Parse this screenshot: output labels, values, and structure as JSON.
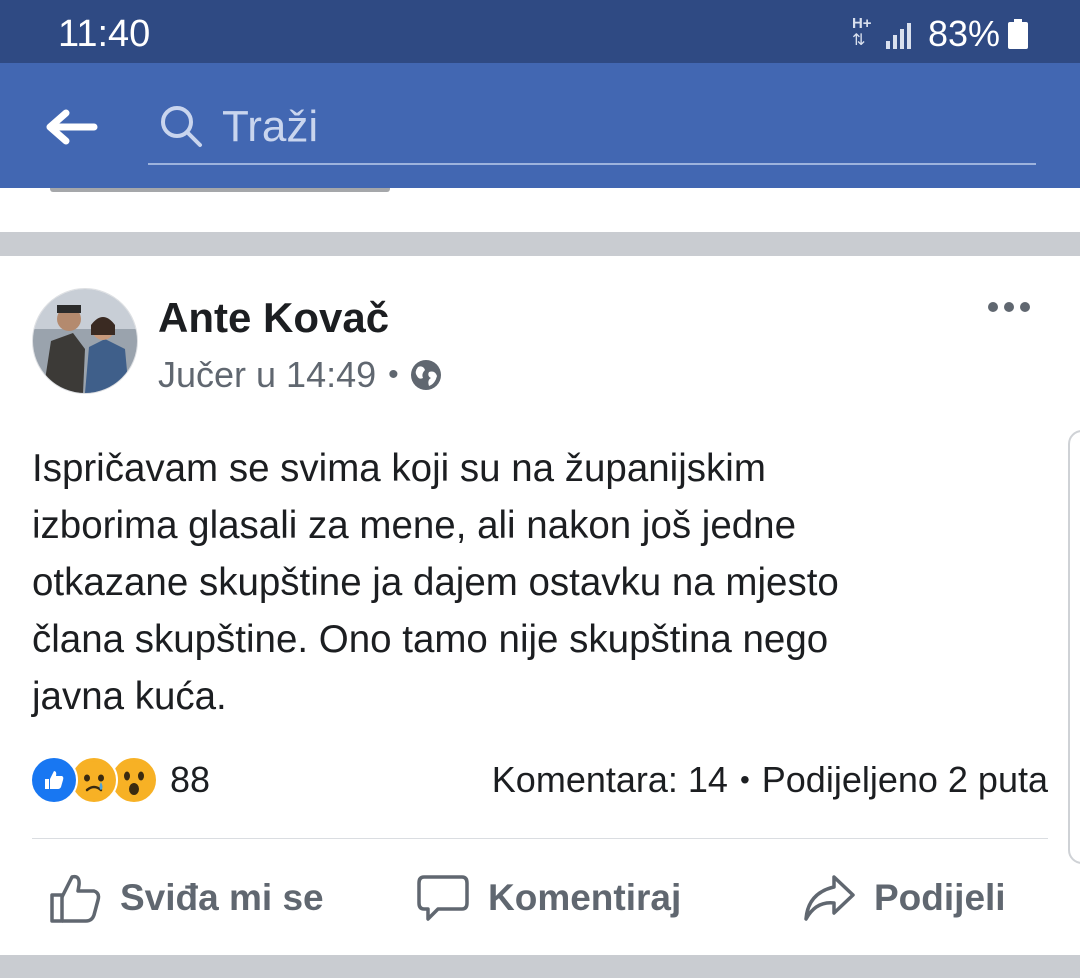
{
  "status_bar": {
    "time": "11:40",
    "network_type": "H+",
    "battery_percent": "83%",
    "icons": [
      "network-type-icon",
      "signal-icon",
      "battery-icon"
    ]
  },
  "search_bar": {
    "placeholder": "Traži",
    "icons": [
      "back-arrow-icon",
      "search-icon"
    ]
  },
  "post": {
    "author": "Ante Kovač",
    "timestamp": "Jučer u 14:49",
    "meta_separator": "•",
    "privacy_icon": "globe-icon",
    "text": "Ispričavam se svima koji su na županijskim\nizborima glasali za mene, ali nakon još jedne\notkazane skupštine ja dajem ostavku na mjesto\nčlana skupštine. Ono tamo nije skupština nego\njavna kuća.",
    "reactions": {
      "icons": [
        "like-reaction-icon",
        "sad-reaction-icon",
        "wow-reaction-icon"
      ],
      "count": "88"
    },
    "stats": {
      "comments": "Komentara: 14",
      "separator": "•",
      "shares": "Podijeljeno 2 puta"
    },
    "actions": {
      "like": "Sviđa mi se",
      "comment": "Komentiraj",
      "share": "Podijeli"
    }
  },
  "colors": {
    "status_bar_bg": "#2f4a83",
    "header_bg": "#4267b2",
    "separator": "#c9ccd1",
    "text_primary": "#1c1e21",
    "text_secondary": "#606770",
    "like_blue": "#1877f2",
    "reaction_yellow": "#f7b125"
  }
}
